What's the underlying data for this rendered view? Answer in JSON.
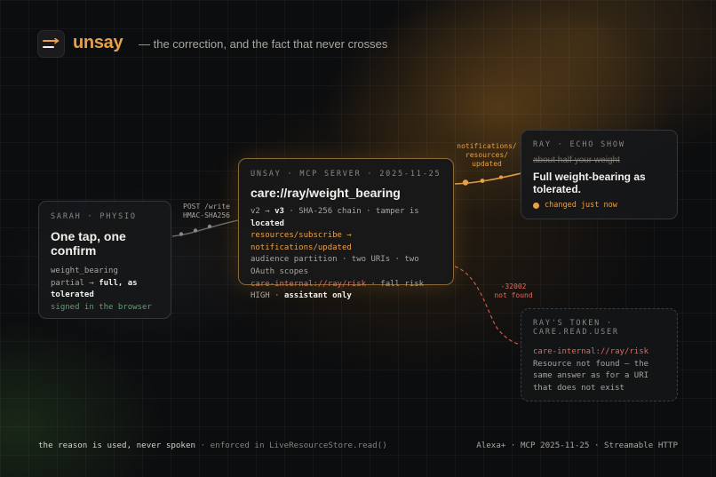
{
  "header": {
    "brand": "unsay",
    "tagline": "— the correction, and the fact that never crosses",
    "logo_icon": "stacked-lines-arrow-icon",
    "accent": "#e9a04a"
  },
  "sarah": {
    "eyebrow": "SARAH · PHYSIO",
    "title": "One tap, one confirm",
    "line1": "weight_bearing",
    "line2_a": "partial →",
    "line2_b": "full, as tolerated",
    "status": "signed in the browser"
  },
  "edge_post": {
    "line1": "POST /write",
    "line2": "HMAC-SHA256"
  },
  "server": {
    "eyebrow": "UNSAY · MCP SERVER · 2025-11-25",
    "title": "care://ray/weight_bearing",
    "l1_a": "v2 →",
    "l1_b": "v3",
    "l1_c": "· SHA-256 chain · tamper is",
    "l1_d": "located",
    "l2": "resources/subscribe → notifications/updated",
    "l3": "audience partition · two URIs · two OAuth scopes",
    "l4_a": "care-internal://ray/risk",
    "l4_b": "· fall risk HIGH ·",
    "l4_c": "assistant only"
  },
  "edge_notif": {
    "line1": "notifications/",
    "line2": "resources/",
    "line3": "updated"
  },
  "echo": {
    "eyebrow": "RAY · ECHO SHOW",
    "old_text": "about half your weight",
    "title": "Full weight-bearing as tolerated.",
    "status": "changed just now"
  },
  "edge_err": {
    "line1": "-32002",
    "line2": "not found"
  },
  "token": {
    "eyebrow": "RAY'S TOKEN · care.read.user",
    "uri": "care-internal://ray/risk",
    "message": "Resource not found — the same answer as for a URI that does not exist"
  },
  "footer": {
    "left_main": "the reason is used, never spoken",
    "left_muted": "· enforced in LiveResourceStore.read()",
    "right": "Alexa+ · MCP 2025-11-25 · Streamable HTTP"
  }
}
